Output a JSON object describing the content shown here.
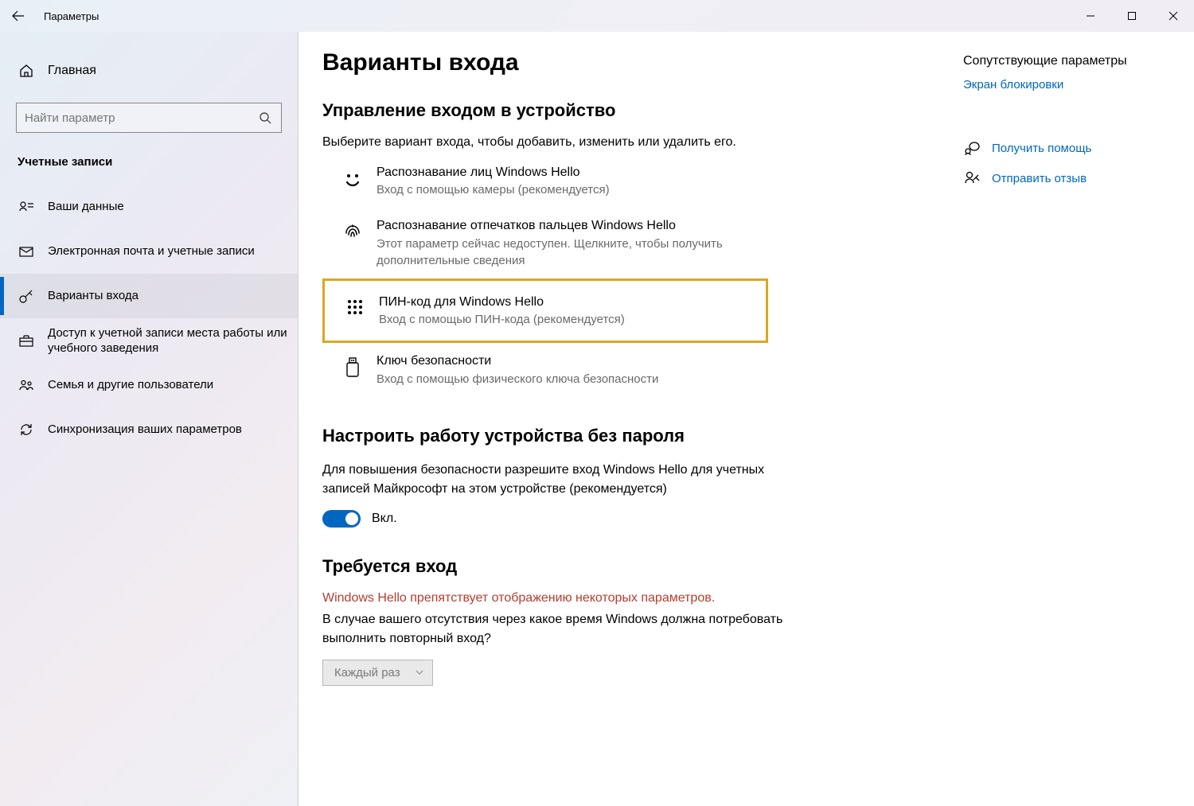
{
  "window": {
    "title": "Параметры"
  },
  "sidebar": {
    "home_label": "Главная",
    "search_placeholder": "Найти параметр",
    "section": "Учетные записи",
    "items": [
      {
        "label": "Ваши данные"
      },
      {
        "label": "Электронная почта и учетные записи"
      },
      {
        "label": "Варианты входа"
      },
      {
        "label": "Доступ к учетной записи места работы или учебного заведения"
      },
      {
        "label": "Семья и другие пользователи"
      },
      {
        "label": "Синхронизация ваших параметров"
      }
    ]
  },
  "main": {
    "heading": "Варианты входа",
    "section1_title": "Управление входом в устройство",
    "section1_desc": "Выберите вариант входа, чтобы добавить, изменить или удалить его.",
    "options": [
      {
        "title": "Распознавание лиц Windows Hello",
        "sub": "Вход с помощью камеры (рекомендуется)"
      },
      {
        "title": "Распознавание отпечатков пальцев Windows Hello",
        "sub": "Этот параметр сейчас недоступен. Щелкните, чтобы получить дополнительные сведения"
      },
      {
        "title": "ПИН-код для Windows Hello",
        "sub": "Вход с помощью ПИН-кода (рекомендуется)"
      },
      {
        "title": "Ключ безопасности",
        "sub": "Вход с помощью физического ключа безопасности"
      }
    ],
    "section2_title": "Настроить работу устройства без пароля",
    "section2_desc": "Для повышения безопасности разрешите вход Windows Hello для учетных записей Майкрософт на этом устройстве (рекомендуется)",
    "toggle_label": "Вкл.",
    "section3_title": "Требуется вход",
    "section3_warn": "Windows Hello препятствует отображению некоторых параметров.",
    "section3_desc": "В случае вашего отсутствия через какое время Windows должна потребовать выполнить повторный вход?",
    "dropdown_value": "Каждый раз"
  },
  "right": {
    "related_title": "Сопутствующие параметры",
    "related_link": "Экран блокировки",
    "help_label": "Получить помощь",
    "feedback_label": "Отправить отзыв"
  }
}
